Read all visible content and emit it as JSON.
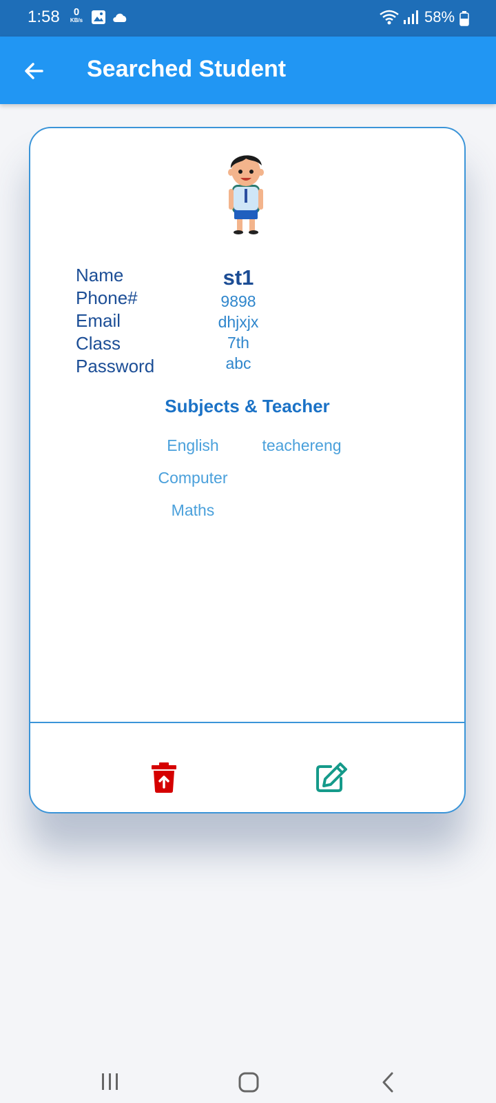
{
  "status_bar": {
    "time": "1:58",
    "net_speed_value": "0",
    "net_speed_unit": "KB/s",
    "battery": "58%",
    "icons": [
      "gallery-icon",
      "cloud-icon",
      "wifi-icon",
      "signal-icon",
      "battery-icon"
    ]
  },
  "app_bar": {
    "title": "Searched Student",
    "back_icon": "arrow-left-icon",
    "color": "#2196f3"
  },
  "student": {
    "labels": {
      "name": "Name",
      "phone": "Phone#",
      "email": "Email",
      "class": "Class",
      "password": "Password"
    },
    "values": {
      "name": "st1",
      "phone": "9898",
      "email": "dhjxjx",
      "class": "7th",
      "password": "abc"
    }
  },
  "subjects_section": {
    "title": "Subjects  &  Teacher",
    "items": [
      {
        "subject": "English",
        "teacher": "teachereng"
      },
      {
        "subject": "Computer",
        "teacher": ""
      },
      {
        "subject": "Maths",
        "teacher": ""
      }
    ]
  },
  "actions": {
    "delete_icon": "trash-icon",
    "delete_color": "#d50000",
    "edit_icon": "edit-icon",
    "edit_color": "#159a8a"
  },
  "nav_bar": {
    "icons": [
      "recent-apps-icon",
      "home-icon",
      "back-icon"
    ]
  }
}
